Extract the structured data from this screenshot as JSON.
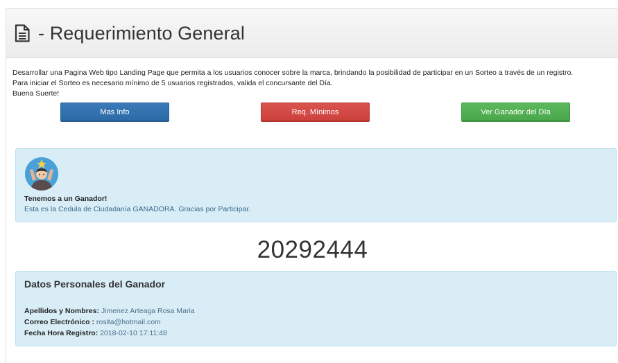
{
  "header": {
    "title": "- Requerimiento General",
    "icon": "document-icon"
  },
  "description": {
    "line1": "Desarrollar una Pagina Web tipo Landing Page que permita a los usuarios conocer sobre la marca, brindando la posibilidad de participar en un Sorteo a través de un registro.",
    "line2": "Para iniciar el Sorteo es necesario mínimo de 5 usuarios registrados, valida el concursante del Día.",
    "line3": "Buena Suerte!"
  },
  "buttons": {
    "mas_info": "Mas Info",
    "req_minimos": "Req. Mínimos",
    "ver_ganador": "Ver Ganador del Día"
  },
  "winner": {
    "title": "Tenemos a un Ganador!",
    "text": "Esta es la Cedula de Ciudadanía GANADORA. Gracias por Participar.",
    "avatar_icon": "winner-avatar-icon"
  },
  "winning_number": "20292444",
  "personal_data": {
    "title": "Datos Personales del Ganador",
    "names_label": "Apellidos y Nombres:",
    "names_value": "Jimenez Arteaga Rosa Maria",
    "email_label": "Correo Electrónico :",
    "email_value": "rosita@hotmail.com",
    "date_label": "Fecha Hora Registro:",
    "date_value": "2018-02-10 17:11:48"
  },
  "colors": {
    "primary": "#337ab7",
    "danger": "#d9534f",
    "success": "#5cb85c",
    "info_bg": "#d9edf7"
  }
}
